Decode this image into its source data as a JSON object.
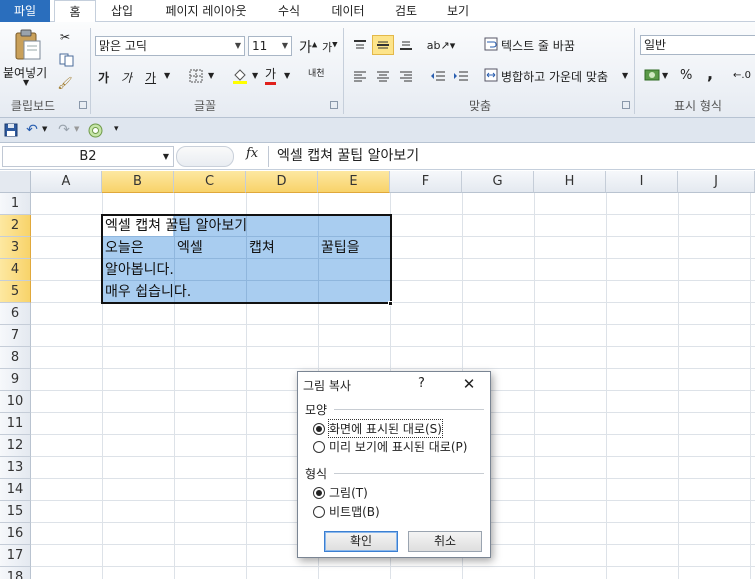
{
  "tabs": {
    "file": "파일",
    "home": "홈",
    "insert": "삽입",
    "page_layout": "페이지 레이아웃",
    "formulas": "수식",
    "data": "데이터",
    "review": "검토",
    "view": "보기"
  },
  "ribbon": {
    "clipboard": {
      "paste": "붙여넣기",
      "label": "클립보드"
    },
    "font": {
      "name": "맑은 고딕",
      "size": "11",
      "grow": "가",
      "shrink": "가",
      "bold": "가",
      "italic": "가",
      "underline": "가",
      "color_char": "가",
      "phonetic": "내천",
      "label": "글꼴"
    },
    "alignment": {
      "wrap": "텍스트 줄 바꿈",
      "merge": "병합하고 가운데 맞춤",
      "label": "맞춤"
    },
    "number": {
      "format": "일반",
      "percent": "%",
      "comma": ",",
      "label": "표시 형식"
    }
  },
  "formula_bar": {
    "name_box": "B2",
    "fx": "fx",
    "content": "엑셀 캡쳐 꿀팁 알아보기"
  },
  "columns": [
    "A",
    "B",
    "C",
    "D",
    "E",
    "F",
    "G",
    "H",
    "I",
    "J"
  ],
  "rows": [
    "1",
    "2",
    "3",
    "4",
    "5",
    "6",
    "7",
    "8",
    "9",
    "10",
    "11",
    "12",
    "13",
    "14",
    "15",
    "16",
    "17",
    "18"
  ],
  "cells": {
    "b2": "엑셀 캡쳐 꿀팁 알아보기",
    "b3": "오늘은",
    "c3": "엑셀",
    "d3": "캡쳐",
    "e3": "꿀팁을",
    "b4": "알아봅니다.",
    "b5": "매우 쉽습니다."
  },
  "dialog": {
    "title": "그림 복사",
    "help": "?",
    "close": "✕",
    "appearance_label": "모양",
    "opt_as_shown": "화면에 표시된 대로(S)",
    "opt_as_printed": "미리 보기에 표시된 대로(P)",
    "format_label": "형식",
    "opt_picture": "그림(T)",
    "opt_bitmap": "비트맵(B)",
    "ok": "확인",
    "cancel": "취소"
  },
  "colors": {
    "file_tab": "#2a6ebd",
    "selection": "#a9cdf0",
    "header_highlight": "#f8d36a"
  }
}
